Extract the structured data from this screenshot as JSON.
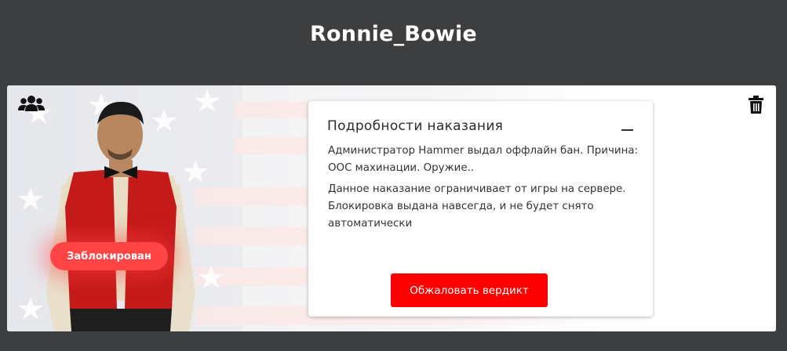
{
  "header": {
    "username": "Ronnie_Bowie"
  },
  "profile": {
    "status_badge": "Заблокирован",
    "status_color": "#ff4545",
    "left_icon": "users-group-icon",
    "right_icon": "trash-icon"
  },
  "punishment": {
    "title": "Подробности наказания",
    "collapse_icon": "minus-icon",
    "reason_text": "Администратор Hammer выдал оффлайн бан. Причина: ООС махинации. Оружие..",
    "description_text": "Данное наказание ограничивает от игры на сервере. Блокировка выдана навсегда, и не будет снято автоматически",
    "appeal_button": "Обжаловать вердикт",
    "accent_color": "#ff0000"
  }
}
